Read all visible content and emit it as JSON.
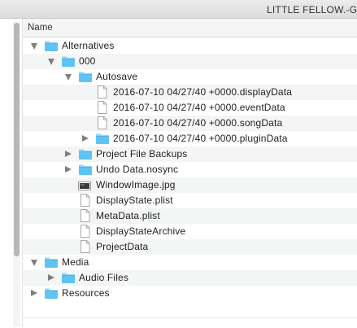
{
  "window": {
    "title": "LITTLE FELLOW.-GSV"
  },
  "columns": {
    "name_header": "Name"
  },
  "tree": [
    {
      "label": "Alternatives",
      "type": "folder",
      "depth": 0,
      "disclosure": "open"
    },
    {
      "label": "000",
      "type": "folder",
      "depth": 1,
      "disclosure": "open"
    },
    {
      "label": "Autosave",
      "type": "folder",
      "depth": 2,
      "disclosure": "open"
    },
    {
      "label": "2016-07-10 04/27/40 +0000.displayData",
      "type": "file",
      "depth": 3,
      "disclosure": "none"
    },
    {
      "label": "2016-07-10 04/27/40 +0000.eventData",
      "type": "file",
      "depth": 3,
      "disclosure": "none"
    },
    {
      "label": "2016-07-10 04/27/40 +0000.songData",
      "type": "file",
      "depth": 3,
      "disclosure": "none"
    },
    {
      "label": "2016-07-10 04/27/40 +0000.pluginData",
      "type": "folder",
      "depth": 3,
      "disclosure": "closed"
    },
    {
      "label": "Project File Backups",
      "type": "folder",
      "depth": 2,
      "disclosure": "closed"
    },
    {
      "label": "Undo Data.nosync",
      "type": "folder",
      "depth": 2,
      "disclosure": "closed"
    },
    {
      "label": "WindowImage.jpg",
      "type": "image",
      "depth": 2,
      "disclosure": "none"
    },
    {
      "label": "DisplayState.plist",
      "type": "file",
      "depth": 2,
      "disclosure": "none"
    },
    {
      "label": "MetaData.plist",
      "type": "file",
      "depth": 2,
      "disclosure": "none"
    },
    {
      "label": "DisplayStateArchive",
      "type": "file",
      "depth": 2,
      "disclosure": "none"
    },
    {
      "label": "ProjectData",
      "type": "file",
      "depth": 2,
      "disclosure": "none"
    },
    {
      "label": "Media",
      "type": "folder",
      "depth": 0,
      "disclosure": "open"
    },
    {
      "label": "Audio Files",
      "type": "folder",
      "depth": 1,
      "disclosure": "closed"
    },
    {
      "label": "Resources",
      "type": "folder",
      "depth": 0,
      "disclosure": "closed"
    }
  ],
  "colors": {
    "folder_fill": "#5fc4f4",
    "folder_tab": "#8fd6f8",
    "disclosure": "#7f7f7f",
    "row_stripe": "#f4f5f5"
  }
}
